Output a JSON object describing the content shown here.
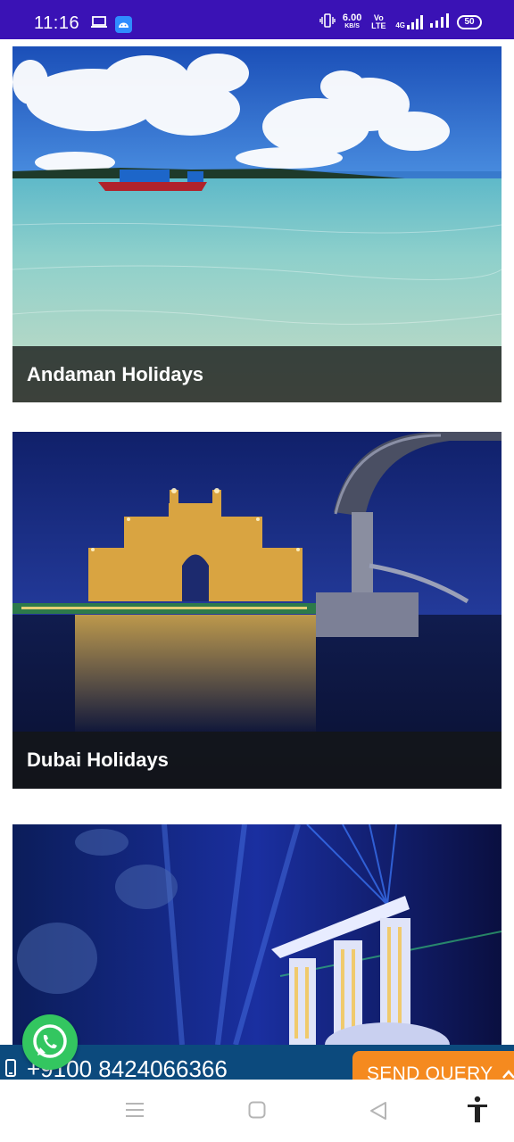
{
  "status_bar": {
    "time": "11:16",
    "net_speed": "6.00",
    "net_speed_unit": "KB/S",
    "volte": "Vo LTE",
    "network_type": "4G",
    "battery": "50",
    "background_color": "#3a12b5"
  },
  "cards": [
    {
      "title": "Andaman Holidays",
      "image": "andaman-beach-boat-photo"
    },
    {
      "title": "Dubai Holidays",
      "image": "dubai-atlantis-night-photo"
    },
    {
      "title": "",
      "image": "singapore-marina-bay-lasers-photo"
    }
  ],
  "contact_bar": {
    "phone": "+9100 8424066366",
    "send_query_label": "SEND QUERY",
    "background_color": "#0c4a7d",
    "button_color": "#f58a1f"
  },
  "whatsapp": {
    "icon": "whatsapp-icon",
    "color": "#33c660"
  },
  "nav_bar": {
    "items": [
      "recent-apps-icon",
      "home-icon",
      "back-icon",
      "accessibility-icon"
    ]
  }
}
